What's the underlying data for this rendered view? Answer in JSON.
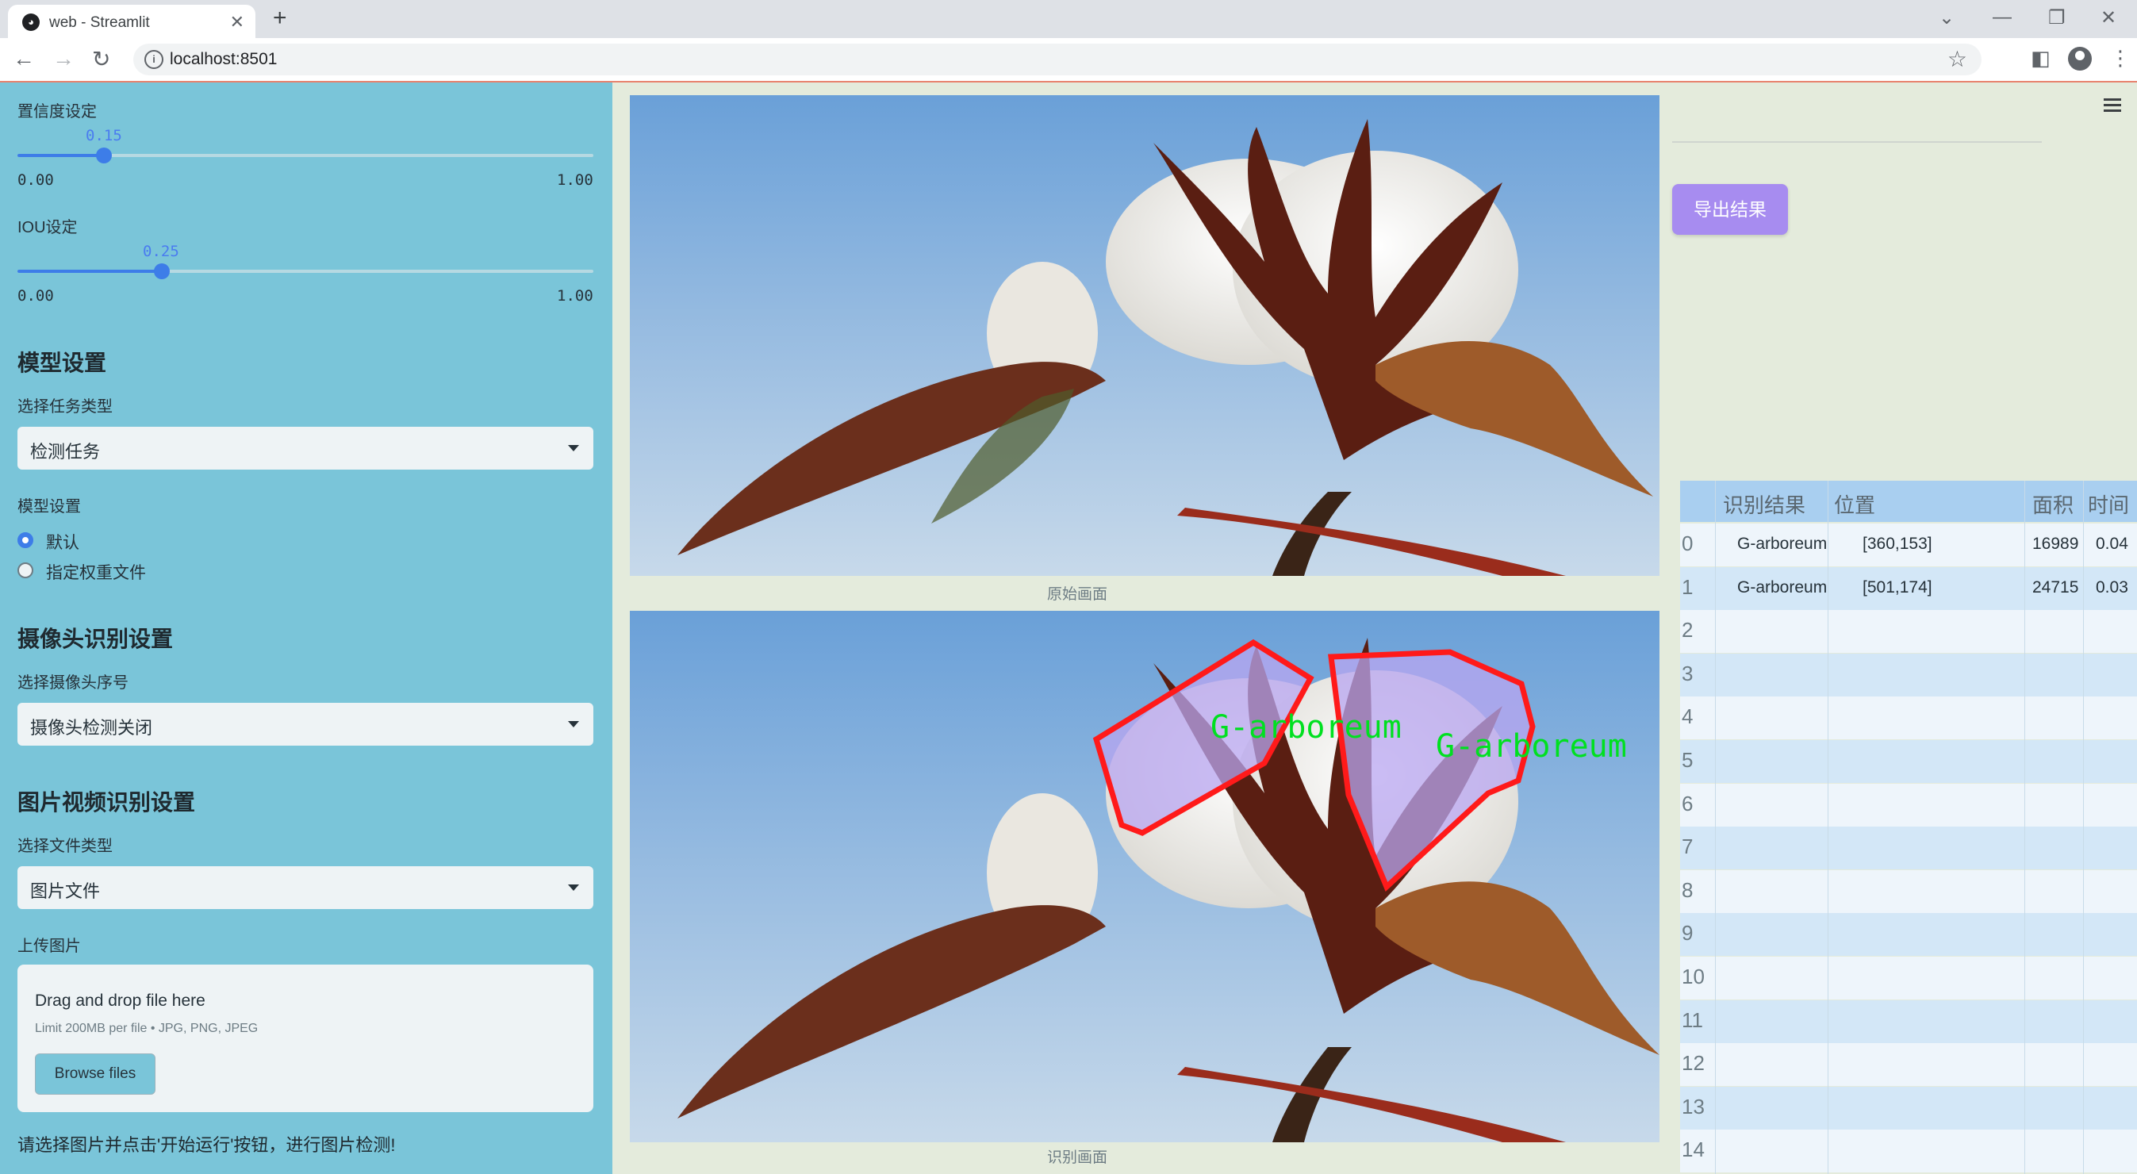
{
  "browser": {
    "tab_title": "web - Streamlit",
    "url": "localhost:8501"
  },
  "sidebar": {
    "confidence": {
      "label": "置信度设定",
      "value_text": "0.15",
      "value": 0.15,
      "min": "0.00",
      "max": "1.00"
    },
    "iou": {
      "label": "IOU设定",
      "value_text": "0.25",
      "value": 0.25,
      "min": "0.00",
      "max": "1.00"
    },
    "model_section": "模型设置",
    "task_label": "选择任务类型",
    "task_value": "检测任务",
    "model_label": "模型设置",
    "model_options": [
      "默认",
      "指定权重文件"
    ],
    "camera_section": "摄像头识别设置",
    "camera_label": "选择摄像头序号",
    "camera_value": "摄像头检测关闭",
    "media_section": "图片视频识别设置",
    "filetype_label": "选择文件类型",
    "filetype_value": "图片文件",
    "upload_label": "上传图片",
    "upload_drag": "Drag and drop file here",
    "upload_limit": "Limit 200MB per file • JPG, PNG, JPEG",
    "browse_label": "Browse files",
    "hint": "请选择图片并点击'开始运行'按钮，进行图片检测!"
  },
  "main": {
    "original_caption": "原始画面",
    "result_caption": "识别画面",
    "detection_label_text": "G-arboreum"
  },
  "results": {
    "export_label": "导出结果",
    "columns": [
      "识别结果",
      "位置",
      "面积",
      "时间"
    ],
    "rows": [
      {
        "idx": "0",
        "label": "G-arboreum",
        "pos": "[360,153]",
        "area": "16989",
        "time": "0.04"
      },
      {
        "idx": "1",
        "label": "G-arboreum",
        "pos": "[501,174]",
        "area": "24715",
        "time": "0.03"
      },
      {
        "idx": "2"
      },
      {
        "idx": "3"
      },
      {
        "idx": "4"
      },
      {
        "idx": "5"
      },
      {
        "idx": "6"
      },
      {
        "idx": "7"
      },
      {
        "idx": "8"
      },
      {
        "idx": "9"
      },
      {
        "idx": "10"
      },
      {
        "idx": "11"
      },
      {
        "idx": "12"
      },
      {
        "idx": "13"
      },
      {
        "idx": "14"
      }
    ]
  },
  "colors": {
    "sidebar_bg": "#7ac5d9",
    "accent": "#3d7de8",
    "export_button": "#a78cf0",
    "detection_box": "#ff1a1a",
    "detection_text": "#00e020"
  }
}
